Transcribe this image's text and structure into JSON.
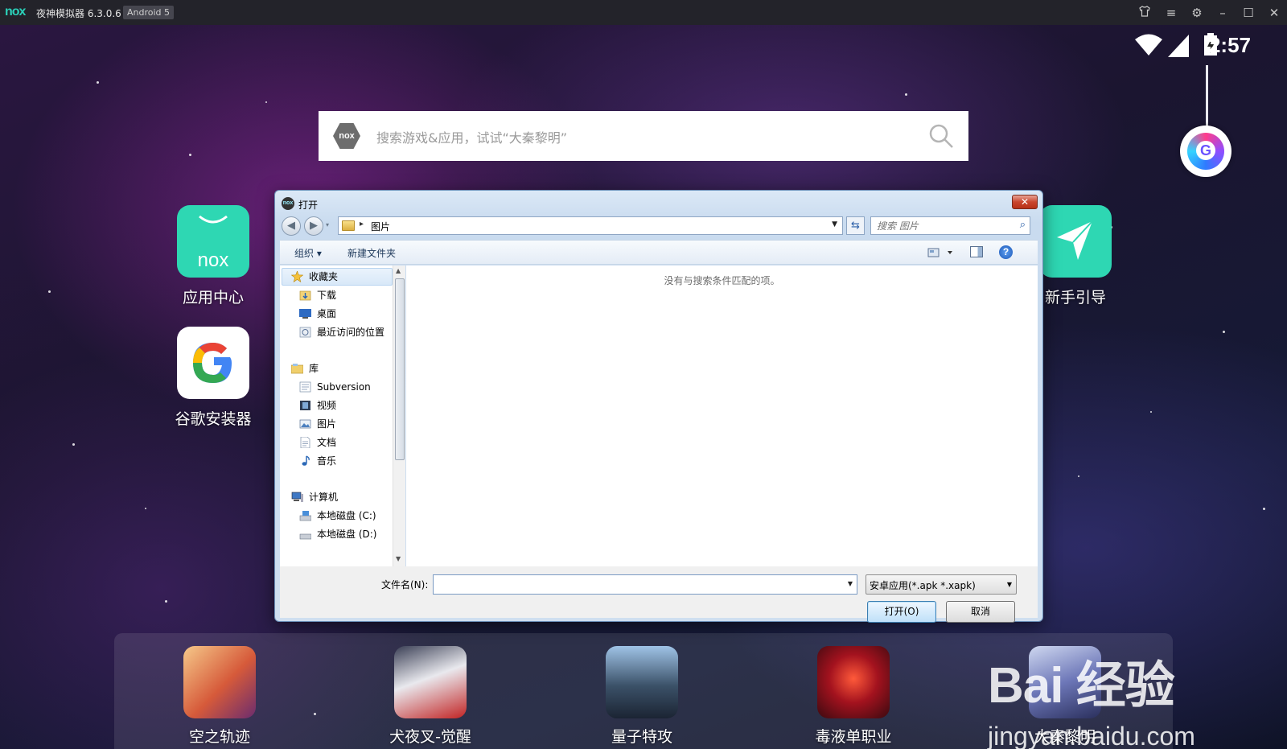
{
  "titlebar": {
    "logo": "nox",
    "title": "夜神模拟器 6.3.0.6",
    "badge": "Android 5",
    "icons": [
      "tshirt-icon",
      "menu-icon",
      "gear-icon",
      "minimize-icon",
      "maximize-icon",
      "close-icon"
    ]
  },
  "statusbar": {
    "time": "2:57",
    "icons": [
      "wifi-icon",
      "signal-icon",
      "battery-charging-icon"
    ]
  },
  "search": {
    "logo": "nox",
    "placeholder": "搜索游戏&应用，试试“大秦黎明”"
  },
  "desktop_apps": [
    {
      "label": "应用中心",
      "icon": "nox-app-center-icon",
      "color": "#2ed7b3"
    },
    {
      "label": "谷歌安装器",
      "icon": "google-installer-icon",
      "color": "#ffffff"
    },
    {
      "label": "新手引导",
      "icon": "paper-plane-icon",
      "color": "#2ed7b3"
    }
  ],
  "dock_apps": [
    {
      "label": "空之轨迹",
      "icon": "game-sora-icon"
    },
    {
      "label": "犬夜叉-觉醒",
      "icon": "game-inuyasha-icon"
    },
    {
      "label": "量子特攻",
      "icon": "game-quantum-icon"
    },
    {
      "label": "毒液单职业",
      "icon": "game-venom-icon"
    },
    {
      "label": "大秦黎明",
      "icon": "game-daqin-icon"
    }
  ],
  "dialog": {
    "title": "打开",
    "close_label": "✕",
    "path": "图片",
    "search_placeholder": "搜索 图片",
    "toolbar": {
      "organize": "组织 ▾",
      "new_folder": "新建文件夹",
      "help": "?"
    },
    "nav": {
      "favorites": {
        "label": "收藏夹",
        "items": [
          "下载",
          "桌面",
          "最近访问的位置"
        ]
      },
      "libraries": {
        "label": "库",
        "items": [
          "Subversion",
          "视频",
          "图片",
          "文档",
          "音乐"
        ]
      },
      "computer": {
        "label": "计算机",
        "items": [
          "本地磁盘 (C:)",
          "本地磁盘 (D:)"
        ]
      }
    },
    "empty_message": "没有与搜索条件匹配的项。",
    "filename_label": "文件名(N):",
    "filename_value": "",
    "filetype": "安卓应用(*.apk *.xapk)",
    "open_label": "打开(O)",
    "cancel_label": "取消"
  },
  "watermark": {
    "brand": "Bai 经验",
    "url": "jingyan.baidu.com"
  }
}
